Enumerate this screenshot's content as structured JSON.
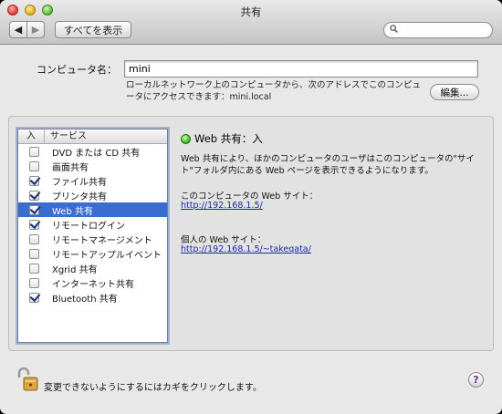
{
  "window": {
    "title": "共有"
  },
  "toolbar": {
    "back_glyph": "◀",
    "forward_glyph": "▶",
    "show_all_label": "すべてを表示",
    "search_placeholder": "",
    "search_icon": "magnifier-icon"
  },
  "computer": {
    "label": "コンピュータ名：",
    "name_value": "mini",
    "description": "ローカルネットワーク上のコンピュータから、次のアドレスでこのコンピュータにアクセスできます：mini.local",
    "edit_label": "編集..."
  },
  "services": {
    "header_on": "入",
    "header_service": "サービス",
    "items": [
      {
        "label": "DVD または CD 共有",
        "checked": false
      },
      {
        "label": "画面共有",
        "checked": false
      },
      {
        "label": "ファイル共有",
        "checked": true
      },
      {
        "label": "プリンタ共有",
        "checked": true
      },
      {
        "label": "Web 共有",
        "checked": true,
        "selected": true
      },
      {
        "label": "リモートログイン",
        "checked": true
      },
      {
        "label": "リモートマネージメント",
        "checked": false
      },
      {
        "label": "リモートアップルイベント",
        "checked": false
      },
      {
        "label": "Xgrid 共有",
        "checked": false
      },
      {
        "label": "インターネット共有",
        "checked": false
      },
      {
        "label": "Bluetooth 共有",
        "checked": true
      }
    ]
  },
  "detail": {
    "status_title": "Web 共有：入",
    "status_color": "#3fbd24",
    "description": "Web 共有により、ほかのコンピュータのユーザはこのコンピュータの\"サイト\"フォルダ内にある Web ページを表示できるようになります。",
    "computer_site_label": "このコンピュータの Web サイト：",
    "computer_site_url": "http://192.168.1.5/",
    "personal_site_label": "個人の Web サイト：",
    "personal_site_url": "http://192.168.1.5/~takeqata/"
  },
  "footer": {
    "lock_icon": "unlocked-padlock-icon",
    "lock_text": "変更できないようにするにはカギをクリックします。",
    "help_label": "?"
  }
}
